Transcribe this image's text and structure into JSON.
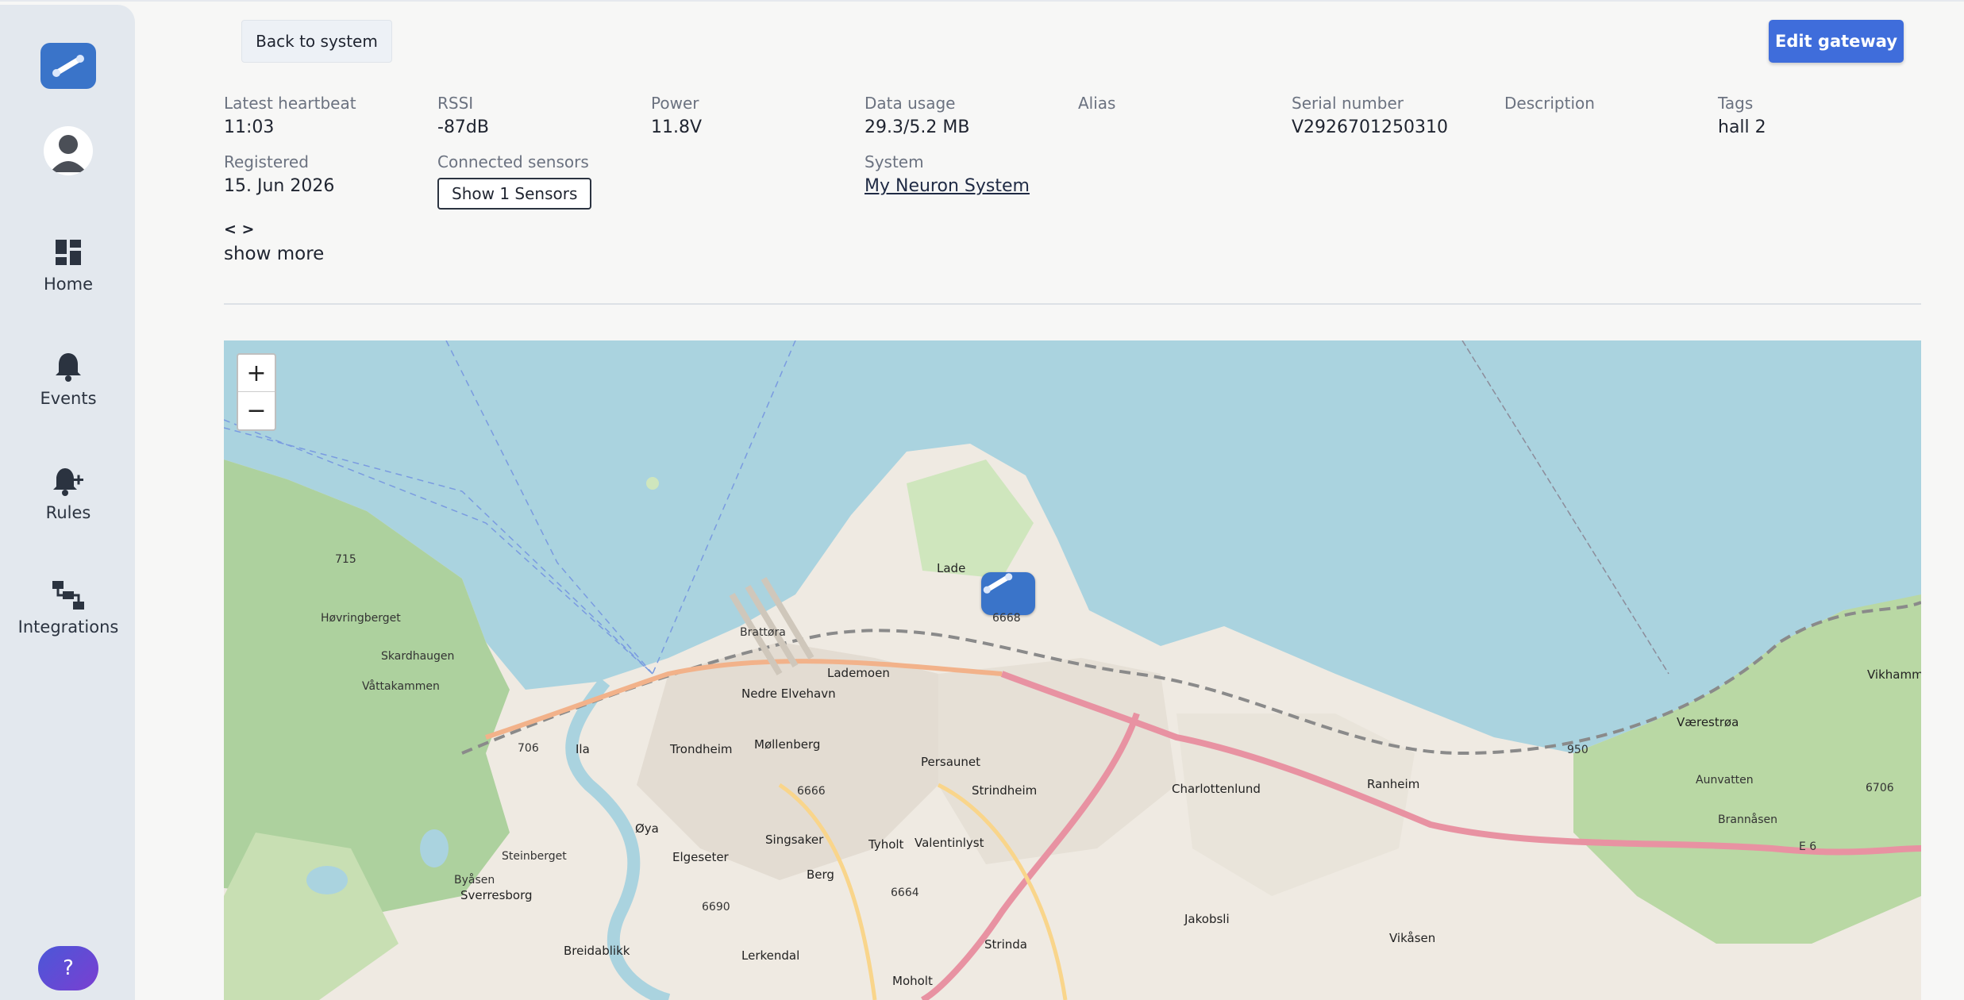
{
  "sidebar": {
    "items": [
      {
        "label": "Home",
        "icon": "dashboard-icon"
      },
      {
        "label": "Events",
        "icon": "bell-icon"
      },
      {
        "label": "Rules",
        "icon": "bell-plus-icon"
      },
      {
        "label": "Integrations",
        "icon": "flow-icon"
      }
    ],
    "help_label": "?"
  },
  "header": {
    "back_label": "Back to system",
    "edit_label": "Edit gateway"
  },
  "gateway": {
    "latest_heartbeat": {
      "label": "Latest heartbeat",
      "value": "11:03"
    },
    "rssi": {
      "label": "RSSI",
      "value": "-87dB"
    },
    "power": {
      "label": "Power",
      "value": "11.8V"
    },
    "data_usage": {
      "label": "Data usage",
      "value": "29.3/5.2 MB"
    },
    "alias": {
      "label": "Alias",
      "value": ""
    },
    "serial": {
      "label": "Serial number",
      "value": "V2926701250310"
    },
    "description": {
      "label": "Description",
      "value": ""
    },
    "tags": {
      "label": "Tags",
      "value": "hall 2"
    },
    "registered": {
      "label": "Registered",
      "value": "15. Jun 2026"
    },
    "connected_sensors": {
      "label": "Connected sensors",
      "button": "Show 1 Sensors"
    },
    "system": {
      "label": "System",
      "value": "My Neuron System"
    },
    "code_toggle": "< >",
    "show_more": "show more"
  },
  "map": {
    "zoom_in": "+",
    "zoom_out": "−",
    "colors": {
      "water": "#aad3df",
      "land": "#f2efe9",
      "forest": "#add19e",
      "road": "#e892a2"
    },
    "labels": [
      {
        "id": "lade",
        "text": "Lade"
      },
      {
        "id": "trondheim",
        "text": "Trondheim"
      },
      {
        "id": "nedre-elvehavn",
        "text": "Nedre Elvehavn"
      },
      {
        "id": "lademoen",
        "text": "Lademoen"
      },
      {
        "id": "mollenberg",
        "text": "Møllenberg"
      },
      {
        "id": "persaunet",
        "text": "Persaunet"
      },
      {
        "id": "strindheim",
        "text": "Strindheim"
      },
      {
        "id": "charlottenlund",
        "text": "Charlottenlund"
      },
      {
        "id": "ranheim",
        "text": "Ranheim"
      },
      {
        "id": "vaerestroa",
        "text": "Værestrøa"
      },
      {
        "id": "vikhammer",
        "text": "Vikhammer"
      },
      {
        "id": "ila",
        "text": "Ila"
      },
      {
        "id": "oya",
        "text": "Øya"
      },
      {
        "id": "elgeseter",
        "text": "Elgeseter"
      },
      {
        "id": "singsaker",
        "text": "Singsaker"
      },
      {
        "id": "tyholt",
        "text": "Tyholt"
      },
      {
        "id": "valentinlyst",
        "text": "Valentinlyst"
      },
      {
        "id": "berg",
        "text": "Berg"
      },
      {
        "id": "sverresborg",
        "text": "Sverresborg"
      },
      {
        "id": "breidablikk",
        "text": "Breidablikk"
      },
      {
        "id": "lerkendal",
        "text": "Lerkendal"
      },
      {
        "id": "strinda",
        "text": "Strinda"
      },
      {
        "id": "moholt",
        "text": "Moholt"
      },
      {
        "id": "jakobsli",
        "text": "Jakobsli"
      },
      {
        "id": "vikasen",
        "text": "Vikåsen"
      },
      {
        "id": "brattora",
        "text": "Brattøra"
      },
      {
        "id": "hovringberget",
        "text": "Høvringberget"
      },
      {
        "id": "skardhaugen",
        "text": "Skardhaugen"
      },
      {
        "id": "vattakammen",
        "text": "Våttakammen"
      },
      {
        "id": "steinberget",
        "text": "Steinberget"
      },
      {
        "id": "bymarka",
        "text": "Byåsen"
      },
      {
        "id": "brannasen",
        "text": "Brannåsen"
      },
      {
        "id": "aunvatten",
        "text": "Aunvatten"
      },
      {
        "id": "road-715",
        "text": "715"
      },
      {
        "id": "road-706",
        "text": "706"
      },
      {
        "id": "road-6666",
        "text": "6666"
      },
      {
        "id": "road-6668",
        "text": "6668"
      },
      {
        "id": "road-6690",
        "text": "6690"
      },
      {
        "id": "road-6664",
        "text": "6664"
      },
      {
        "id": "road-950",
        "text": "950"
      },
      {
        "id": "road-e6",
        "text": "E 6"
      },
      {
        "id": "road-6706",
        "text": "6706"
      }
    ]
  }
}
